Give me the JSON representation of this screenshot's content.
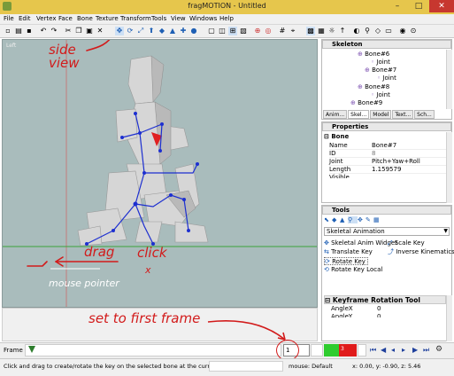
{
  "window": {
    "title": "fragMOTION - Untitled",
    "minimize": "–",
    "maximize": "□",
    "close": "✕"
  },
  "menu": [
    "File",
    "Edit",
    "Vertex",
    "Face",
    "Bone",
    "Texture",
    "Transform",
    "Tools",
    "View",
    "Windows",
    "Help"
  ],
  "viewport": {
    "label": "Left"
  },
  "skeleton": {
    "title": "Skeleton",
    "tree": [
      "Bone#6",
      "Joint",
      "Bone#7",
      "Joint",
      "Bone#8",
      "Joint",
      "Bone#9"
    ],
    "tabs": [
      "Anim...",
      "Skel...",
      "Model",
      "Text...",
      "Sch..."
    ]
  },
  "properties": {
    "title": "Properties",
    "section": "Bone",
    "rows": [
      {
        "k": "Name",
        "v": "Bone#7"
      },
      {
        "k": "ID",
        "v": "8"
      },
      {
        "k": "Joint",
        "v": "Pitch+Yaw+Roll"
      },
      {
        "k": "Length",
        "v": "1.159579"
      },
      {
        "k": "Visible",
        "v": ""
      }
    ]
  },
  "tools": {
    "title": "Tools",
    "dropdown": "Skeletal Animation",
    "items_left": [
      "Skeletal Anim Widget",
      "Translate Key",
      "Rotate Key",
      "Rotate Key Local"
    ],
    "items_right": [
      "Scale Key",
      "Inverse Kinematics"
    ],
    "keyframe_title": "Keyframe Rotation Tool",
    "keyframe_rows": [
      {
        "k": "AngleX",
        "v": "0"
      },
      {
        "k": "AngleY",
        "v": "0"
      }
    ]
  },
  "timeline": {
    "label": "Frame",
    "frame_value": "1",
    "frame_marker": "3"
  },
  "status": {
    "message": "Click and drag to create/rotate the key on the selected bone at the current fram",
    "mouse": "mouse: Default",
    "coords": "x: 0.00, y: -0.90, z: 5.46"
  },
  "annotations": {
    "side_view": "side\nview",
    "drag": "drag",
    "click": "click",
    "x_mark": "x",
    "mouse_pointer": "mouse pointer",
    "set_first": "set to first frame"
  }
}
